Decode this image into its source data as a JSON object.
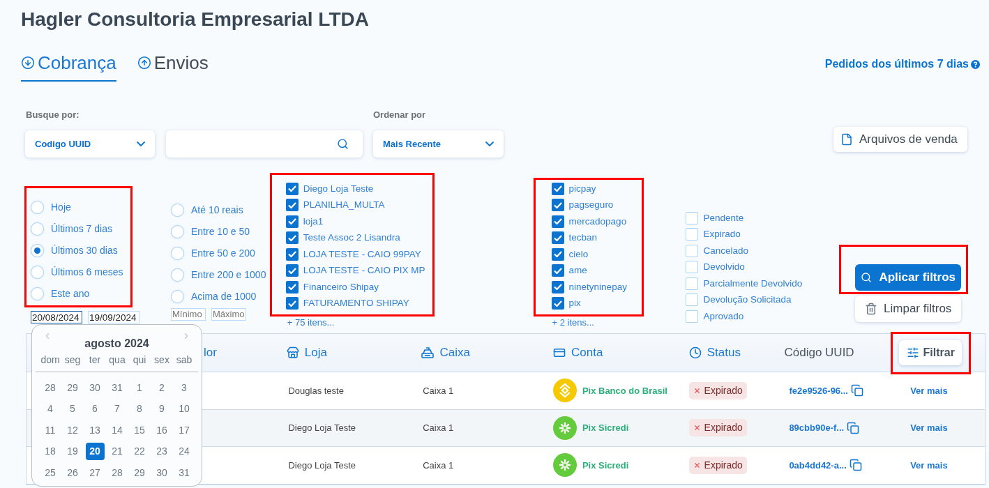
{
  "title": "Hagler Consultoria Empresarial LTDA",
  "tabs": [
    {
      "label": "Cobrança",
      "kind": "incoming",
      "selected": true
    },
    {
      "label": "Envios",
      "kind": "outgoing",
      "selected": false
    }
  ],
  "period_link": "Pedidos dos últimos 7 dias",
  "search": {
    "label": "Busque por:",
    "search_by": "Codigo UUID"
  },
  "sort": {
    "label": "Ordenar por",
    "value": "Mais Recente"
  },
  "sales_files_button": "Arquivos de venda",
  "date_filter": {
    "options": [
      {
        "label": "Hoje",
        "selected": false
      },
      {
        "label": "Últimos 7 dias",
        "selected": false
      },
      {
        "label": "Últimos 30 dias",
        "selected": true
      },
      {
        "label": "Últimos 6 meses",
        "selected": false
      },
      {
        "label": "Este ano",
        "selected": false
      }
    ],
    "start_date": "20/08/2024",
    "end_date": "19/09/2024"
  },
  "value_filter": {
    "options": [
      {
        "label": "Até 10 reais",
        "selected": false
      },
      {
        "label": "Entre 10 e 50",
        "selected": false
      },
      {
        "label": "Entre 50 e 200",
        "selected": false
      },
      {
        "label": "Entre 200 e 1000",
        "selected": false
      },
      {
        "label": "Acima de 1000",
        "selected": false
      }
    ],
    "min": {
      "placeholder": "Mínimo"
    },
    "max": {
      "placeholder": "Máximo"
    }
  },
  "stores": {
    "items": [
      {
        "label": "Diego Loja Teste",
        "checked": true
      },
      {
        "label": "PLANILHA_MULTA",
        "checked": true
      },
      {
        "label": "loja1",
        "checked": true
      },
      {
        "label": "Teste Assoc 2 Lisandra",
        "checked": true
      },
      {
        "label": "LOJA TESTE - CAIO 99PAY",
        "checked": true
      },
      {
        "label": "LOJA TESTE - CAIO PIX MP",
        "checked": true
      },
      {
        "label": "Financeiro Shipay",
        "checked": true
      },
      {
        "label": "FATURAMENTO SHIPAY",
        "checked": true
      }
    ],
    "more": "+ 75 itens..."
  },
  "methods": {
    "items": [
      {
        "label": "picpay",
        "checked": true
      },
      {
        "label": "pagseguro",
        "checked": true
      },
      {
        "label": "mercadopago",
        "checked": true
      },
      {
        "label": "tecban",
        "checked": true
      },
      {
        "label": "cielo",
        "checked": true
      },
      {
        "label": "ame",
        "checked": true
      },
      {
        "label": "ninetyninepay",
        "checked": true
      },
      {
        "label": "pix",
        "checked": true
      }
    ],
    "more": "+ 2 itens..."
  },
  "statuses": {
    "items": [
      {
        "label": "Pendente",
        "checked": false
      },
      {
        "label": "Expirado",
        "checked": false
      },
      {
        "label": "Cancelado",
        "checked": false
      },
      {
        "label": "Devolvido",
        "checked": false
      },
      {
        "label": "Parcialmente Devolvido",
        "checked": false
      },
      {
        "label": "Devolução Solicitada",
        "checked": false
      },
      {
        "label": "Aprovado",
        "checked": false
      }
    ]
  },
  "apply_button": "Aplicar filtros",
  "clear_button": "Limpar filtros",
  "table": {
    "columns": [
      {
        "label": "lor",
        "kind": "plain"
      },
      {
        "label": "Loja",
        "kind": "store"
      },
      {
        "label": "Caixa",
        "kind": "register"
      },
      {
        "label": "Conta",
        "kind": "card"
      },
      {
        "label": "Status",
        "kind": "clock"
      },
      {
        "label": "Código UUID",
        "kind": "muted"
      }
    ],
    "filter_button": "Filtrar",
    "rows": [
      {
        "store": "Douglas teste",
        "register": "Caixa 1",
        "account": {
          "name": "Pix Banco do Brasil",
          "kind": "bb"
        },
        "status": "Expirado",
        "uuid": "fe2e9526-96...",
        "action": "Ver mais"
      },
      {
        "store": "Diego Loja Teste",
        "register": "Caixa 1",
        "account": {
          "name": "Pix Sicredi",
          "kind": "sicredi"
        },
        "status": "Expirado",
        "uuid": "89cbb90e-f...",
        "action": "Ver mais"
      },
      {
        "store": "Diego Loja Teste",
        "register": "Caixa 1",
        "account": {
          "name": "Pix Sicredi",
          "kind": "sicredi"
        },
        "status": "Expirado",
        "uuid": "0ab4dd42-a...",
        "action": "Ver mais"
      }
    ]
  },
  "calendar": {
    "month": "agosto 2024",
    "weekdays": [
      "dom",
      "seg",
      "ter",
      "qua",
      "qui",
      "sex",
      "sab"
    ],
    "weeks": [
      [
        {
          "day": "28",
          "selected": false
        },
        {
          "day": "29",
          "selected": false
        },
        {
          "day": "30",
          "selected": false
        },
        {
          "day": "31",
          "selected": false
        },
        {
          "day": "1",
          "selected": false
        },
        {
          "day": "2",
          "selected": false
        },
        {
          "day": "3",
          "selected": false
        }
      ],
      [
        {
          "day": "4",
          "selected": false
        },
        {
          "day": "5",
          "selected": false
        },
        {
          "day": "6",
          "selected": false
        },
        {
          "day": "7",
          "selected": false
        },
        {
          "day": "8",
          "selected": false
        },
        {
          "day": "9",
          "selected": false
        },
        {
          "day": "10",
          "selected": false
        }
      ],
      [
        {
          "day": "11",
          "selected": false
        },
        {
          "day": "12",
          "selected": false
        },
        {
          "day": "13",
          "selected": false
        },
        {
          "day": "14",
          "selected": false
        },
        {
          "day": "15",
          "selected": false
        },
        {
          "day": "16",
          "selected": false
        },
        {
          "day": "17",
          "selected": false
        }
      ],
      [
        {
          "day": "18",
          "selected": false
        },
        {
          "day": "19",
          "selected": false
        },
        {
          "day": "20",
          "selected": true
        },
        {
          "day": "21",
          "selected": false
        },
        {
          "day": "22",
          "selected": false
        },
        {
          "day": "23",
          "selected": false
        },
        {
          "day": "24",
          "selected": false
        }
      ],
      [
        {
          "day": "25",
          "selected": false
        },
        {
          "day": "26",
          "selected": false
        },
        {
          "day": "27",
          "selected": false
        },
        {
          "day": "28",
          "selected": false
        },
        {
          "day": "29",
          "selected": false
        },
        {
          "day": "30",
          "selected": false
        },
        {
          "day": "31",
          "selected": false
        }
      ]
    ]
  }
}
